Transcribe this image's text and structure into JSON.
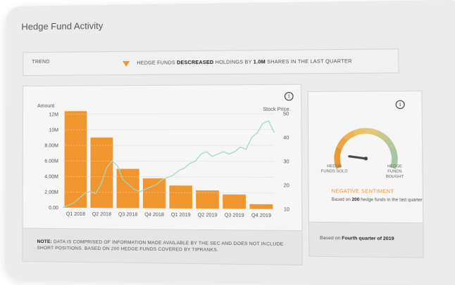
{
  "title": "Hedge Fund Activity",
  "trend": {
    "label": "TREND",
    "text_pre": "HEDGE FUNDS ",
    "text_bold1": "DESCREASED",
    "text_mid": " HOLDINGS BY ",
    "text_bold2": "1.0M",
    "text_post": " SHARES IN THE LAST QUARTER"
  },
  "chart_data": {
    "type": "bar",
    "categories": [
      "Q1 2018",
      "Q2 2018",
      "Q3 2018",
      "Q4 2018",
      "Q1 2019",
      "Q2 2019",
      "Q3 2019",
      "Q4 2019"
    ],
    "series": [
      {
        "name": "Amount",
        "values": [
          12400000,
          9000000,
          5000000,
          3800000,
          2900000,
          2300000,
          1800000,
          600000
        ]
      }
    ],
    "stock_price": [
      10,
      11,
      12,
      14,
      16,
      17,
      16,
      20,
      27,
      30,
      28,
      22,
      20,
      18,
      17,
      18,
      19,
      20,
      22,
      23,
      24,
      26,
      27,
      29,
      30,
      33,
      34,
      32,
      33,
      34,
      33,
      34,
      36,
      35,
      40,
      42,
      46,
      47,
      42
    ],
    "ylabel_left": "Amount",
    "ylabel_right": "Stock Price",
    "left_ticks": [
      "0.00",
      "2.00M",
      "4.00M",
      "6.00M",
      "8.00M",
      "10M",
      "12M"
    ],
    "right_ticks": [
      "10",
      "20",
      "30",
      "40",
      "50"
    ],
    "ylim_left": [
      0,
      12000000
    ],
    "ylim_right": [
      10,
      50
    ],
    "colors": {
      "bar": "#f0962f",
      "line": "#a5d6c5"
    }
  },
  "note": {
    "bold": "NOTE:",
    "text": " DATA IS COMPRISED OF INFORMATION MADE AVAILABLE BY THE SEC AND DOES NOT INCLUDE SHORT POSITIONS. BASED ON 200 HEDGE FUNDS COVERED BY TIPRANKS."
  },
  "sentiment": {
    "left_label": "HEDGE FUNDS SOLD",
    "right_label": "HEDGE FUNDS BOUGHT",
    "status": "NEGATIVE SENTIMENT",
    "sub_pre": "Based on ",
    "sub_bold": "200",
    "sub_post": " hedge funds in the last quarter",
    "level": 0.12,
    "footer_pre": "Based on ",
    "footer_bold": "Fourth quarter of 2019"
  },
  "icons": {
    "info": "i"
  }
}
